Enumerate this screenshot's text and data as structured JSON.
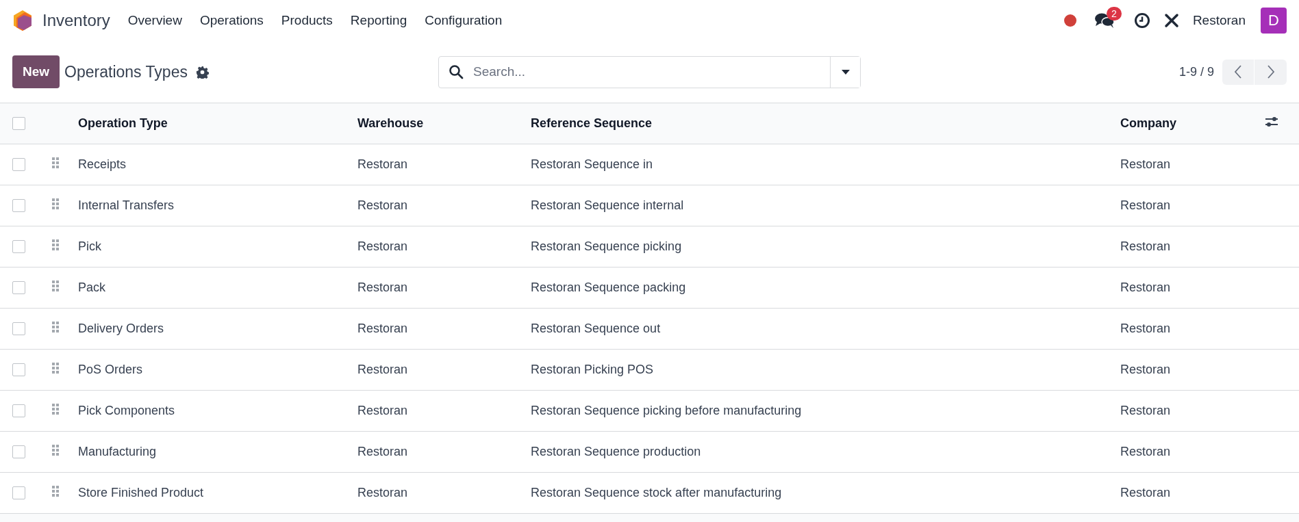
{
  "app": {
    "name": "Inventory"
  },
  "menu": [
    "Overview",
    "Operations",
    "Products",
    "Reporting",
    "Configuration"
  ],
  "systray": {
    "chat_count": "2",
    "company": "Restoran",
    "avatar": "D"
  },
  "control_panel": {
    "new_button": "New",
    "title": "Operations Types",
    "search": {
      "placeholder": "Search..."
    },
    "pager": "1-9 / 9"
  },
  "table": {
    "select_all": {
      "checked": false
    },
    "columns": [
      "Operation Type",
      "Warehouse",
      "Reference Sequence",
      "Company"
    ],
    "rows": [
      {
        "checked": false,
        "cells": [
          "Receipts",
          "Restoran",
          "Restoran Sequence in",
          "Restoran"
        ]
      },
      {
        "checked": false,
        "cells": [
          "Internal Transfers",
          "Restoran",
          "Restoran Sequence internal",
          "Restoran"
        ]
      },
      {
        "checked": false,
        "cells": [
          "Pick",
          "Restoran",
          "Restoran Sequence picking",
          "Restoran"
        ]
      },
      {
        "checked": false,
        "cells": [
          "Pack",
          "Restoran",
          "Restoran Sequence packing",
          "Restoran"
        ]
      },
      {
        "checked": false,
        "cells": [
          "Delivery Orders",
          "Restoran",
          "Restoran Sequence out",
          "Restoran"
        ]
      },
      {
        "checked": false,
        "cells": [
          "PoS Orders",
          "Restoran",
          "Restoran Picking POS",
          "Restoran"
        ]
      },
      {
        "checked": false,
        "cells": [
          "Pick Components",
          "Restoran",
          "Restoran Sequence picking before manufacturing",
          "Restoran"
        ]
      },
      {
        "checked": false,
        "cells": [
          "Manufacturing",
          "Restoran",
          "Restoran Sequence production",
          "Restoran"
        ]
      },
      {
        "checked": false,
        "cells": [
          "Store Finished Product",
          "Restoran",
          "Restoran Sequence stock after manufacturing",
          "Restoran"
        ]
      }
    ]
  }
}
